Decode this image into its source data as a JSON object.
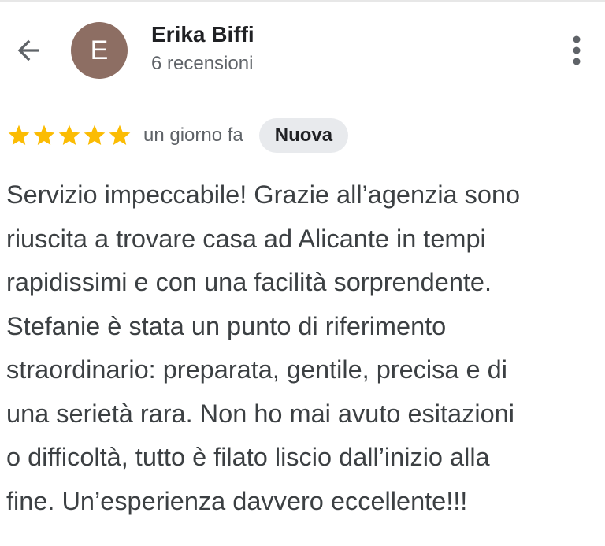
{
  "header": {
    "reviewer_name": "Erika Biffi",
    "review_count": "6 recensioni",
    "avatar_initial": "E",
    "avatar_color": "#8d6e63",
    "back_icon": "arrow-back-icon",
    "more_icon": "more-vert-icon"
  },
  "review": {
    "rating": 5,
    "max_rating": 5,
    "star_color": "#fbbc04",
    "time": "un giorno fa",
    "badge": "Nuova",
    "badge_color": "#e8eaed",
    "lines": [
      "Servizio impeccabile! Grazie all’agenzia sono",
      "riuscita a trovare casa ad Alicante in tempi",
      "rapidissimi e con una facilità sorprendente.",
      "Stefanie è stata un punto di riferimento",
      "straordinario: preparata, gentile, precisa e di",
      "una serietà rara. Non ho mai avuto esitazioni",
      "o difficoltà, tutto è filato liscio dall’inizio alla",
      "fine. Un’esperienza davvero eccellente!!!"
    ]
  }
}
